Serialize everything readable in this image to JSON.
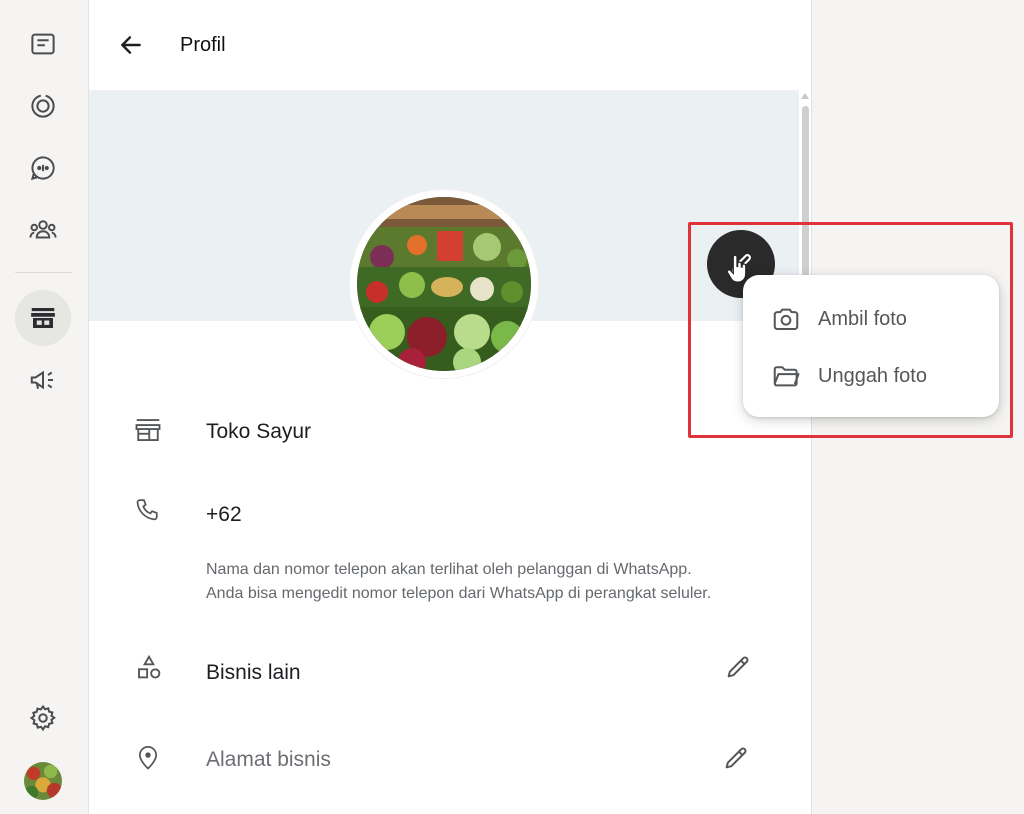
{
  "header": {
    "title": "Profil"
  },
  "rail": {
    "items": [
      {
        "name": "chats-icon"
      },
      {
        "name": "status-icon"
      },
      {
        "name": "channels-icon"
      },
      {
        "name": "communities-icon"
      },
      {
        "name": "business-tools-icon"
      },
      {
        "name": "ads-icon"
      }
    ]
  },
  "profile": {
    "business_name": "Toko Sayur",
    "phone": "+62",
    "hint_line1": "Nama dan nomor telepon akan terlihat oleh pelanggan di WhatsApp.",
    "hint_line2": "Anda bisa mengedit nomor telepon dari WhatsApp di perangkat seluler.",
    "category": "Bisnis lain",
    "address_placeholder": "Alamat bisnis"
  },
  "photo_menu": {
    "take_photo": "Ambil foto",
    "upload_photo": "Unggah foto"
  },
  "colors": {
    "highlight": "#e0323a",
    "banner": "#ebf0f3",
    "fab": "#2a2a2a"
  }
}
